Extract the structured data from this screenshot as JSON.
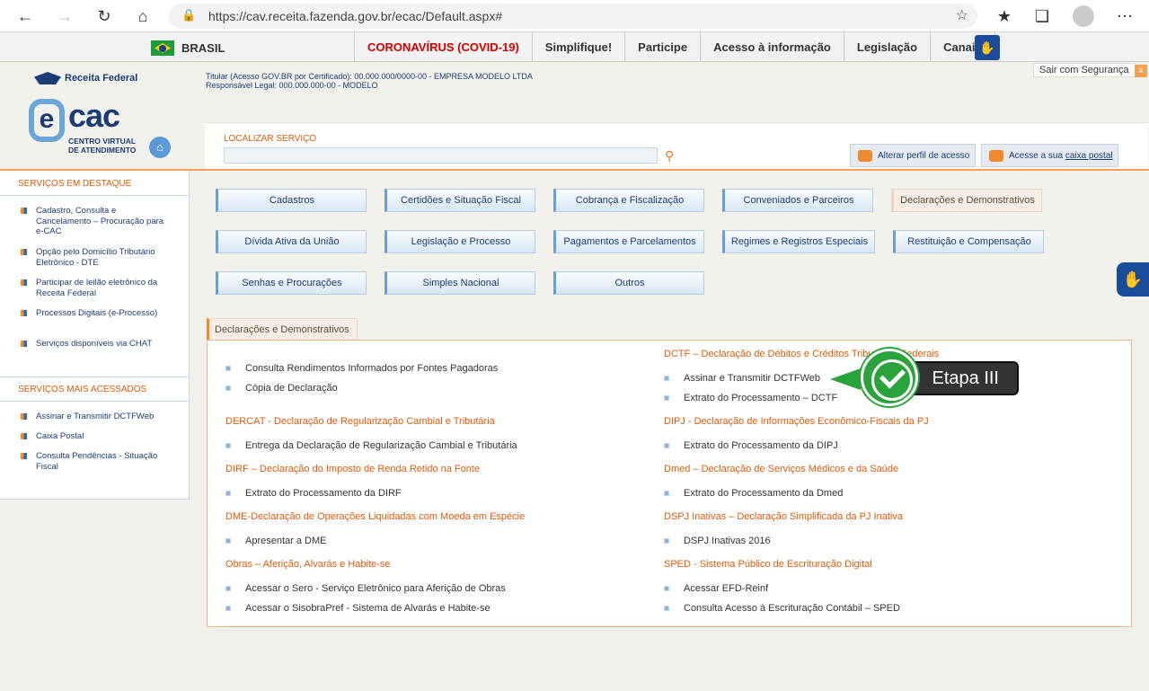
{
  "browser": {
    "url": "https://cav.receita.fazenda.gov.br/ecac/Default.aspx#",
    "back_icon": "arrow-left-icon",
    "forward_icon": "arrow-right-icon",
    "refresh_icon": "refresh-icon",
    "home_icon": "home-icon"
  },
  "gov_bar": {
    "country": "BRASIL",
    "links": [
      "CORONAVÍRUS (COVID-19)",
      "Simplifique!",
      "Participe",
      "Acesso à informação",
      "Legislação",
      "Canais"
    ]
  },
  "header": {
    "receita_label": "Receita Federal",
    "logo_e": "e",
    "logo_cac": "cac",
    "logo_sub1": "CENTRO VIRTUAL",
    "logo_sub2": "DE ATENDIMENTO",
    "titular_line1": "Titular (Acesso GOV.BR por Certificado): 00.000.000/0000-00 - EMPRESA MODELO LTDA",
    "titular_line2": "Responsável Legal: 000.000.000-00 - MODELO",
    "sair": "Sair com Segurança",
    "sair_close": "x"
  },
  "search": {
    "label": "LOCALIZAR SERVIÇO",
    "value": ""
  },
  "profile_button": "Alterar perfil de acesso",
  "postal_prefix": "Acesse a sua ",
  "postal_link": "caixa postal",
  "sidebar": {
    "destaque_title": "SERVIÇOS EM DESTAQUE",
    "destaque_items": [
      "Cadastro, Consulta e Cancelamento – Procuração para e-CAC",
      "Opção pelo Domicílio Tributário Eletrônico - DTE",
      "Participar de leilão eletrônico da Receita Federal",
      "Processos Digitais (e-Processo)",
      "Serviços disponíveis via CHAT"
    ],
    "acessados_title": "SERVIÇOS MAIS ACESSADOS",
    "acessados_items": [
      "Assinar e Transmitir DCTFWeb",
      "Caixa Postal",
      "Consulta Pendências - Situação Fiscal"
    ]
  },
  "categories": [
    "Cadastros",
    "Certidões e Situação Fiscal",
    "Cobrança e Fiscalização",
    "Conveniados e Parceiros",
    "Declarações e Demonstrativos",
    "Dívida Ativa da União",
    "Legislação e Processo",
    "Pagamentos e Parcelamentos",
    "Regimes e Registros Especiais",
    "Restituição e Compensação",
    "Senhas e Procurações",
    "Simples Nacional",
    "Outros"
  ],
  "active_tab": "Declarações e Demonstrativos",
  "panel": {
    "left_top_links": [
      "Consulta Rendimentos Informados por Fontes Pagadoras",
      "Cópia de Declaração"
    ],
    "dercat_title": "DERCAT - Declaração de Regularização Cambial e Tributária",
    "dercat_links": [
      "Entrega da Declaração de Regularização Cambial e Tributária"
    ],
    "dirf_title": "DIRF – Declaração do Imposto de Renda Retido na Fonte",
    "dirf_links": [
      "Extrato do Processamento da DIRF"
    ],
    "dme_title": "DME-Declaração de Operações Liquidadas com Moeda em Espécie",
    "dme_links": [
      "Apresentar a DME"
    ],
    "obras_title": "Obras – Aferição, Alvarás e Habite-se",
    "obras_links": [
      "Acessar o Sero - Serviço Eletrônico para Aferição de Obras",
      "Acessar o SisobraPref - Sistema de Alvarás e Habite-se"
    ],
    "dctf_title": "DCTF – Declaração de Débitos e Créditos Tributários Federais",
    "dctf_links": [
      "Assinar e Transmitir DCTFWeb",
      "Extrato do Processamento – DCTF"
    ],
    "dipj_title": "DIPJ - Declaração de Informações Econômico-Fiscais da PJ",
    "dipj_links": [
      "Extrato do Processamento da DIPJ"
    ],
    "dmed_title": "Dmed – Declaração de Serviços Médicos e da Saúde",
    "dmed_links": [
      "Extrato do Processamento da Dmed"
    ],
    "dspj_title": "DSPJ Inativas – Declaração Simplificada da PJ Inativa",
    "dspj_links": [
      "DSPJ Inativas 2016"
    ],
    "sped_title": "SPED - Sistema Público de Escrituração Digital",
    "sped_links": [
      "Acessar EFD-Reinf",
      "Consulta Acesso à Escrituração Contábil – SPED"
    ]
  },
  "annotation": {
    "label": "Etapa III"
  }
}
